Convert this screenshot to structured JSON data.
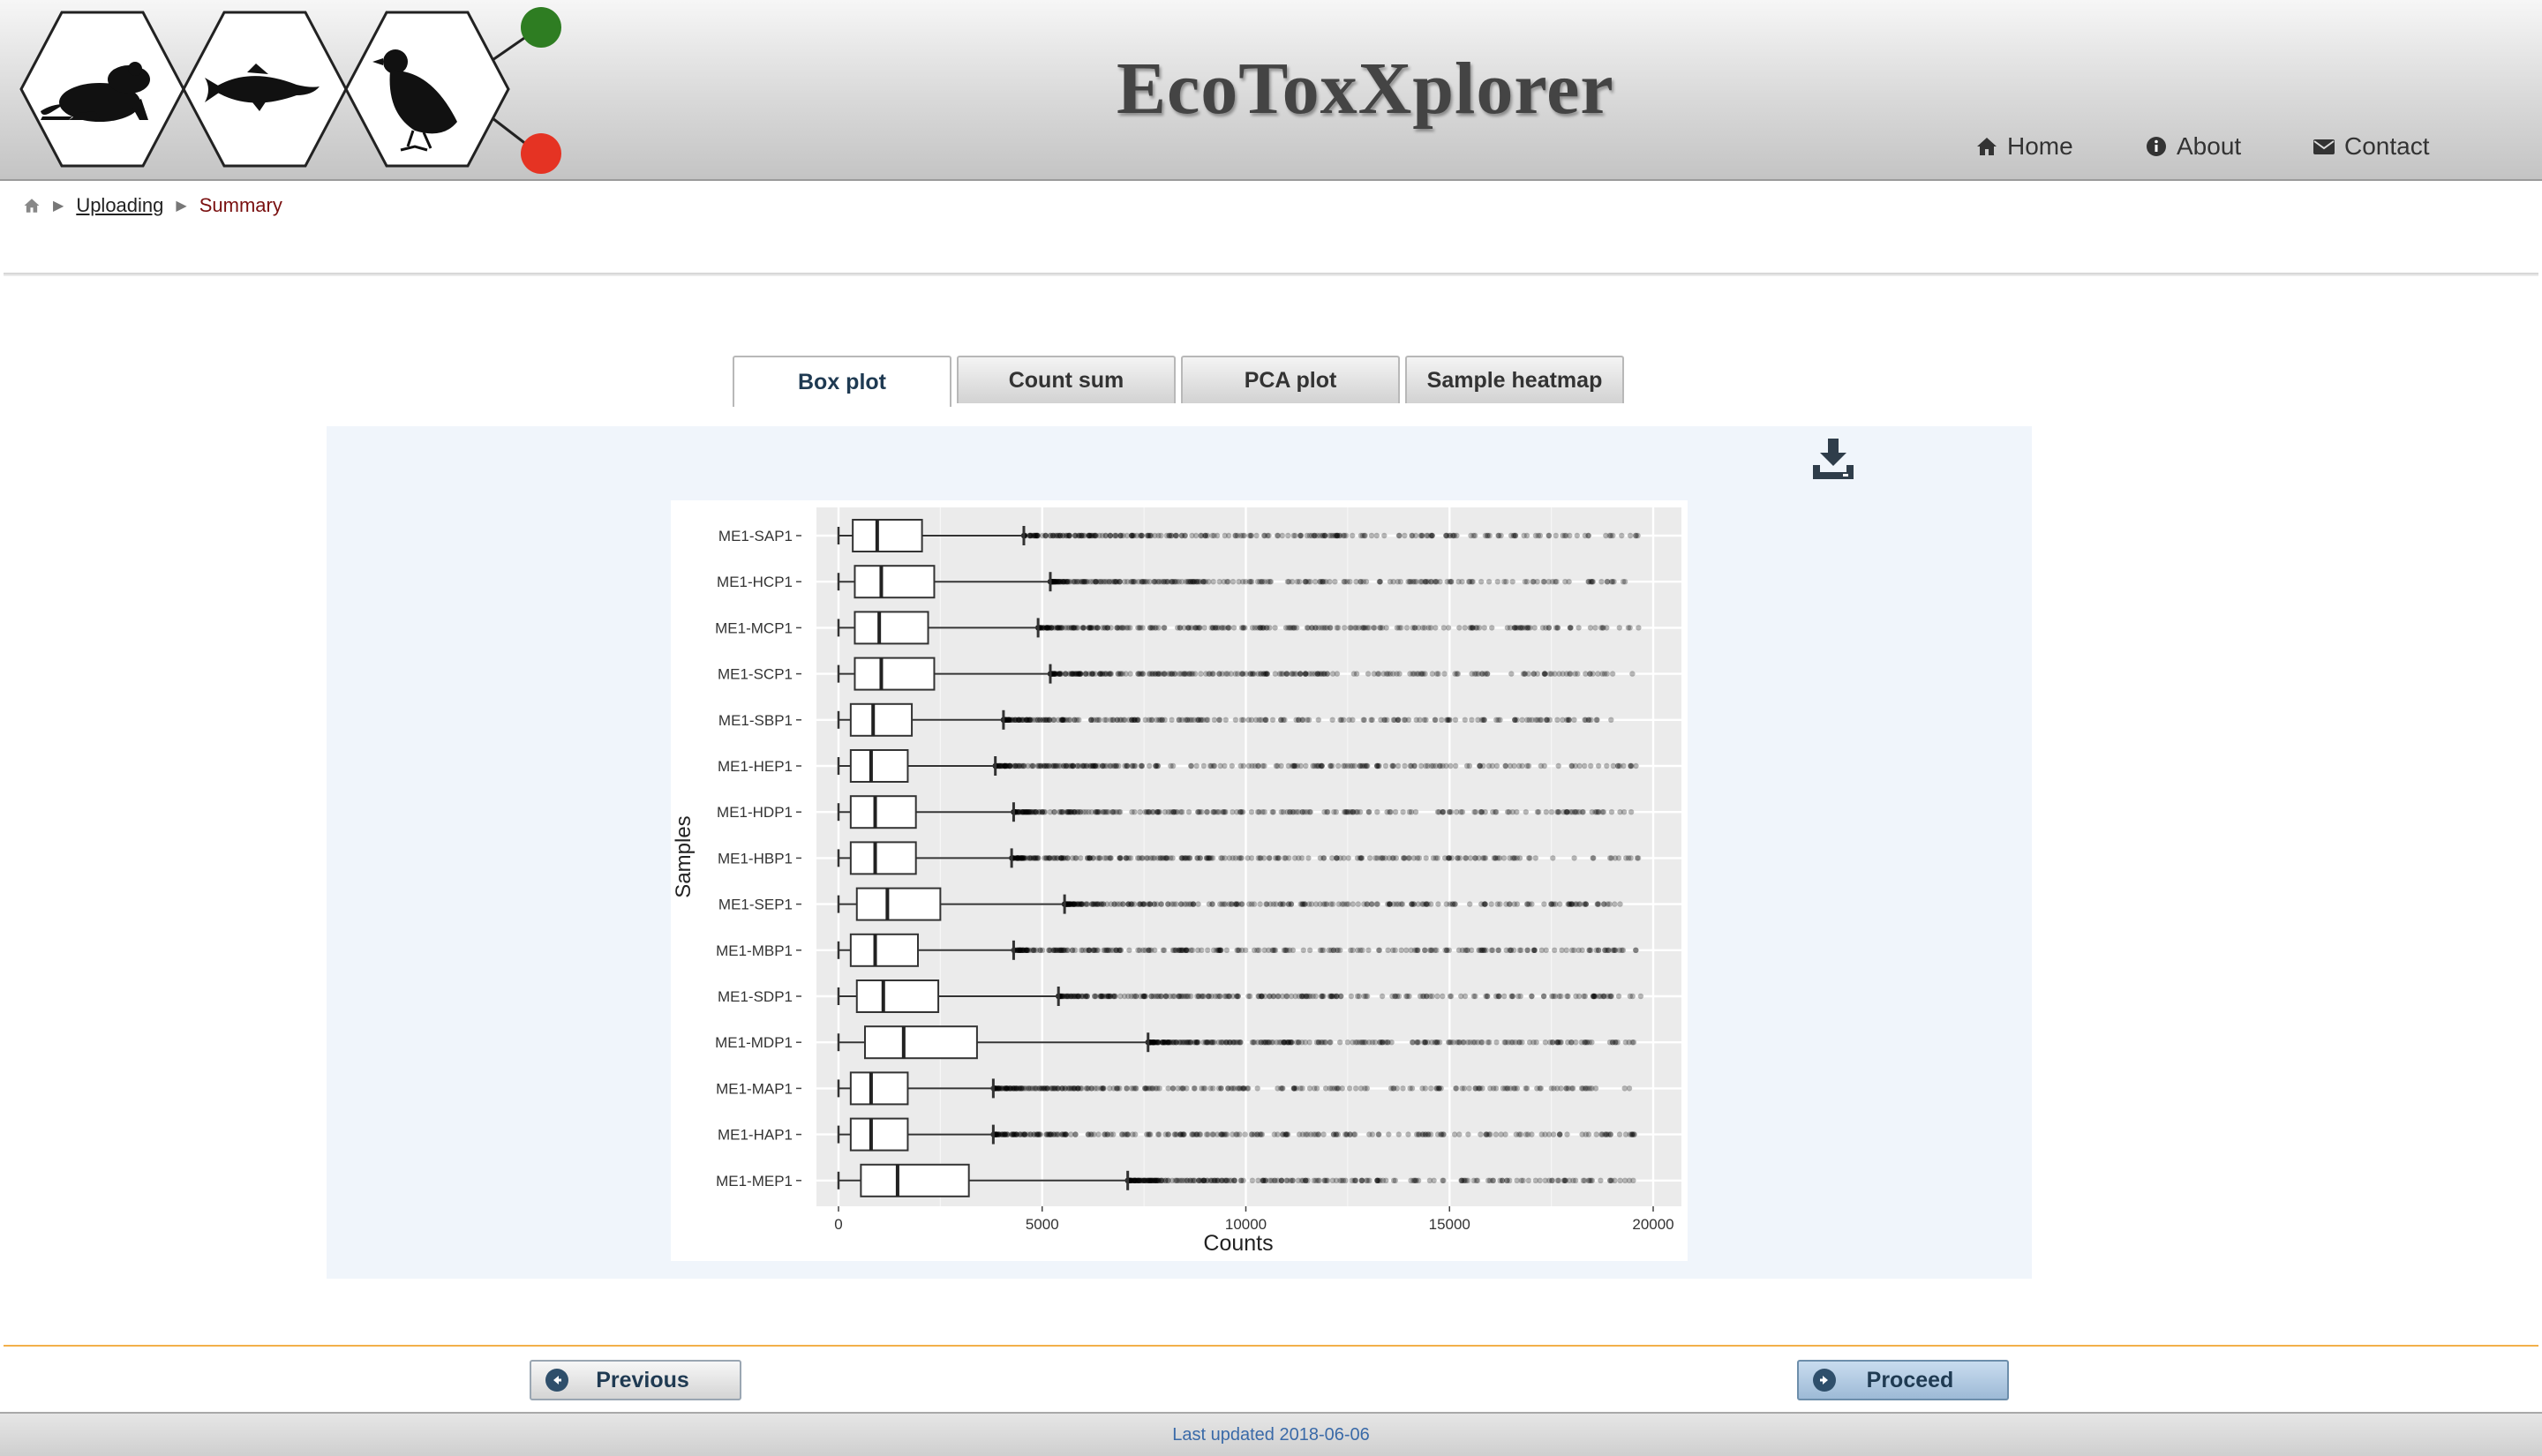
{
  "header": {
    "app_title": "EcoToxXplorer",
    "logo_icons": [
      "frog-icon",
      "fish-icon",
      "bird-icon"
    ],
    "status_colors": {
      "green": "#2e7d22",
      "red": "#e53323"
    },
    "nav": [
      {
        "label": "Home",
        "icon": "home-icon"
      },
      {
        "label": "About",
        "icon": "info-icon"
      },
      {
        "label": "Contact",
        "icon": "envelope-icon"
      }
    ]
  },
  "breadcrumb": {
    "home_icon": "home-icon",
    "items": [
      "Uploading",
      "Summary"
    ]
  },
  "tabs": {
    "items": [
      "Box plot",
      "Count sum",
      "PCA plot",
      "Sample heatmap"
    ],
    "active": "Box plot"
  },
  "panel": {
    "download_icon": "download-icon"
  },
  "chart_data": {
    "type": "box",
    "orientation": "horizontal",
    "xlabel": "Counts",
    "ylabel": "Samples",
    "xlim": [
      0,
      20000
    ],
    "xticks": [
      0,
      5000,
      10000,
      15000,
      20000
    ],
    "xtick_labels": [
      "0",
      "5000",
      "10000",
      "15000",
      "20000"
    ],
    "grid": true,
    "categories": [
      "ME1-SAP1",
      "ME1-HCP1",
      "ME1-MCP1",
      "ME1-SCP1",
      "ME1-SBP1",
      "ME1-HEP1",
      "ME1-HDP1",
      "ME1-HBP1",
      "ME1-SEP1",
      "ME1-MBP1",
      "ME1-SDP1",
      "ME1-MDP1",
      "ME1-MAP1",
      "ME1-HAP1",
      "ME1-MEP1"
    ],
    "boxes": [
      {
        "min": 0,
        "q1": 350,
        "median": 950,
        "q3": 2050,
        "whisker_high": 4550,
        "outlier_max": 19700
      },
      {
        "min": 0,
        "q1": 400,
        "median": 1050,
        "q3": 2350,
        "whisker_high": 5200,
        "outlier_max": 19500
      },
      {
        "min": 0,
        "q1": 400,
        "median": 1000,
        "q3": 2200,
        "whisker_high": 4900,
        "outlier_max": 19700
      },
      {
        "min": 0,
        "q1": 400,
        "median": 1050,
        "q3": 2350,
        "whisker_high": 5200,
        "outlier_max": 19600
      },
      {
        "min": 0,
        "q1": 300,
        "median": 850,
        "q3": 1800,
        "whisker_high": 4050,
        "outlier_max": 19500
      },
      {
        "min": 0,
        "q1": 300,
        "median": 800,
        "q3": 1700,
        "whisker_high": 3850,
        "outlier_max": 19600
      },
      {
        "min": 0,
        "q1": 300,
        "median": 900,
        "q3": 1900,
        "whisker_high": 4300,
        "outlier_max": 19600
      },
      {
        "min": 0,
        "q1": 300,
        "median": 900,
        "q3": 1900,
        "whisker_high": 4250,
        "outlier_max": 19700
      },
      {
        "min": 0,
        "q1": 450,
        "median": 1200,
        "q3": 2500,
        "whisker_high": 5550,
        "outlier_max": 19200
      },
      {
        "min": 0,
        "q1": 300,
        "median": 900,
        "q3": 1950,
        "whisker_high": 4300,
        "outlier_max": 19700
      },
      {
        "min": 0,
        "q1": 450,
        "median": 1100,
        "q3": 2450,
        "whisker_high": 5400,
        "outlier_max": 19700
      },
      {
        "min": 0,
        "q1": 650,
        "median": 1600,
        "q3": 3400,
        "whisker_high": 7600,
        "outlier_max": 19600
      },
      {
        "min": 0,
        "q1": 300,
        "median": 800,
        "q3": 1700,
        "whisker_high": 3800,
        "outlier_max": 19500
      },
      {
        "min": 0,
        "q1": 300,
        "median": 800,
        "q3": 1700,
        "whisker_high": 3800,
        "outlier_max": 19600
      },
      {
        "min": 0,
        "q1": 550,
        "median": 1450,
        "q3": 3200,
        "whisker_high": 7100,
        "outlier_max": 19600
      }
    ]
  },
  "buttons": {
    "previous": "Previous",
    "proceed": "Proceed"
  },
  "footer": {
    "text": "Last updated 2018-06-06"
  }
}
